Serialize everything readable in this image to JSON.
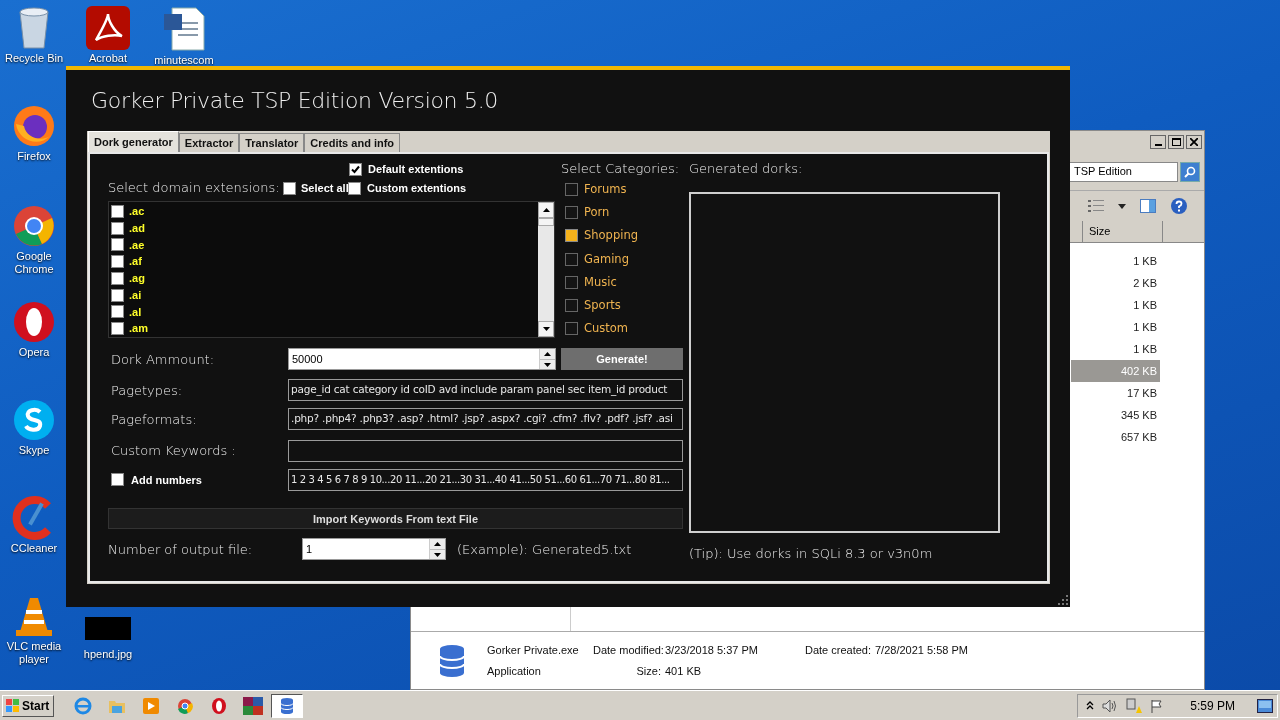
{
  "desktop_icons": [
    {
      "label": "Recycle Bin",
      "kind": "recycle-bin"
    },
    {
      "label": "Acrobat",
      "kind": "acrobat"
    },
    {
      "label": "minutescom",
      "kind": "word-doc"
    },
    {
      "label": "Firefox",
      "kind": "firefox"
    },
    {
      "label": "Google Chrome",
      "kind": "chrome"
    },
    {
      "label": "Opera",
      "kind": "opera"
    },
    {
      "label": "Skype",
      "kind": "skype"
    },
    {
      "label": "CCleaner",
      "kind": "ccleaner"
    },
    {
      "label": "VLC media player",
      "kind": "vlc"
    },
    {
      "label": "hpend.jpg",
      "kind": "image"
    }
  ],
  "explorer": {
    "address": "TSP Edition",
    "column": "Size",
    "sizes": [
      {
        "text": "1 KB",
        "selected": false
      },
      {
        "text": "2 KB",
        "selected": false
      },
      {
        "text": "1 KB",
        "selected": false
      },
      {
        "text": "1 KB",
        "selected": false
      },
      {
        "text": "1 KB",
        "selected": false
      },
      {
        "text": "402 KB",
        "selected": true
      },
      {
        "text": "17 KB",
        "selected": false
      },
      {
        "text": "345 KB",
        "selected": false
      },
      {
        "text": "657 KB",
        "selected": false
      }
    ],
    "details": {
      "name": "Gorker Private.exe",
      "type": "Application",
      "fields": [
        {
          "label": "Date modified:",
          "value": "3/23/2018 5:37 PM"
        },
        {
          "label": "Date created:",
          "value": "7/28/2021 5:58 PM"
        },
        {
          "label": "Size:",
          "value": "401 KB"
        }
      ]
    }
  },
  "app": {
    "title": "Gorker Private TSP Edition Version 5.0",
    "tabs": [
      {
        "label": "Dork generator",
        "selected": true
      },
      {
        "label": "Extractor",
        "selected": false
      },
      {
        "label": "Translator",
        "selected": false
      },
      {
        "label": "Credits and info",
        "selected": false
      }
    ],
    "extensions": {
      "heading": "Select domain extensions:",
      "default": {
        "label": "Default extentions",
        "checked": true
      },
      "select_all": {
        "label": "Select all",
        "checked": false
      },
      "custom": {
        "label": "Custom extentions",
        "checked": false
      },
      "items": [
        {
          "label": ".ac",
          "checked": false
        },
        {
          "label": ".ad",
          "checked": false
        },
        {
          "label": ".ae",
          "checked": false
        },
        {
          "label": ".af",
          "checked": false
        },
        {
          "label": ".ag",
          "checked": false
        },
        {
          "label": ".ai",
          "checked": false
        },
        {
          "label": ".al",
          "checked": false
        },
        {
          "label": ".am",
          "checked": false
        }
      ]
    },
    "categories": {
      "heading": "Select Categories:",
      "items": [
        {
          "label": "Forums",
          "checked": false
        },
        {
          "label": "Porn",
          "checked": false
        },
        {
          "label": "Shopping",
          "checked": true
        },
        {
          "label": "Gaming",
          "checked": false
        },
        {
          "label": "Music",
          "checked": false
        },
        {
          "label": "Sports",
          "checked": false
        },
        {
          "label": "Custom",
          "checked": false
        }
      ]
    },
    "dork_amount": {
      "label": "Dork Ammount:",
      "value": "50000"
    },
    "generate": "Generate!",
    "pagetypes": {
      "label": "Pagetypes:",
      "value": "page_id cat category id coID avd include param panel sec item_id product"
    },
    "pageformats": {
      "label": "Pageformats:",
      "value": ".php? .php4? .php3? .asp? .html? .jsp? .aspx? .cgi? .cfm? .flv? .pdf? .jsf? .asi"
    },
    "custom_keywords": {
      "label": "Custom Keywords :"
    },
    "add_numbers": {
      "label": "Add numbers",
      "checked": false,
      "value": "1 2 3 4 5 6 7 8 9 10...20 11...20 21...30 31...40 41...50 51...60 61...70 71...80 81..."
    },
    "import": "Import Keywords From text File",
    "output": {
      "label": "Number of output file:",
      "value": "1",
      "example": "(Example): Generated5.txt"
    },
    "generated_heading": "Generated dorks:",
    "tip": "(Tip): Use dorks in SQLi 8.3 or v3n0m"
  },
  "taskbar": {
    "start": "Start",
    "items": [
      {
        "kind": "ie",
        "selected": false
      },
      {
        "kind": "explorer",
        "selected": false
      },
      {
        "kind": "media",
        "selected": false
      },
      {
        "kind": "chrome",
        "selected": false
      },
      {
        "kind": "opera",
        "selected": false
      },
      {
        "kind": "winrar",
        "selected": false
      },
      {
        "kind": "app",
        "selected": true
      }
    ],
    "clock": "5:59 PM"
  }
}
